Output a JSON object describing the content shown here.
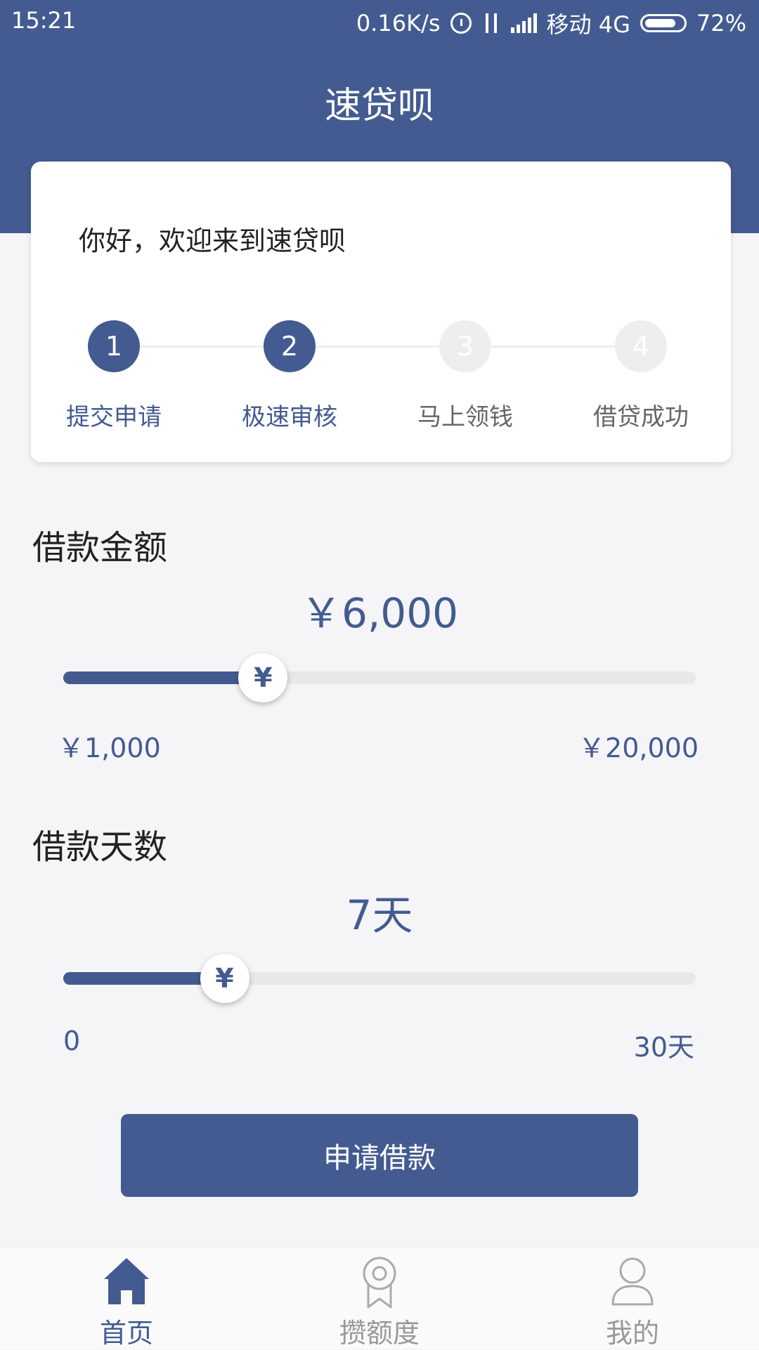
{
  "status_bar": {
    "time": "15:21",
    "speed": "0.16K/s",
    "carrier": "移动 4G",
    "battery": "72%"
  },
  "header": {
    "title": "速贷呗"
  },
  "welcome_card": {
    "greeting": "你好，欢迎来到速贷呗",
    "steps": [
      {
        "number": "1",
        "label": "提交申请",
        "state": "active"
      },
      {
        "number": "2",
        "label": "极速审核",
        "state": "active"
      },
      {
        "number": "3",
        "label": "马上领钱",
        "state": "inactive"
      },
      {
        "number": "4",
        "label": "借贷成功",
        "state": "inactive"
      }
    ]
  },
  "loan_amount": {
    "title": "借款金额",
    "value": "￥6,000",
    "min_label": "￥1,000",
    "max_label": "￥20,000",
    "thumb_symbol": "¥",
    "fraction": 0.316
  },
  "loan_days": {
    "title": "借款天数",
    "value": "7天",
    "min_label": "0",
    "max_label": "30天",
    "thumb_symbol": "¥",
    "fraction": 0.255
  },
  "apply_button": {
    "label": "申请借款"
  },
  "bottom_nav": {
    "items": [
      {
        "label": "首页",
        "icon": "home-icon",
        "active": true
      },
      {
        "label": "攒额度",
        "icon": "badge-icon",
        "active": false
      },
      {
        "label": "我的",
        "icon": "user-icon",
        "active": false
      }
    ]
  },
  "colors": {
    "primary": "#435b90",
    "background": "#f5f5f7",
    "inactive_step": "#eeeeee",
    "slider_track": "#e8e8e8"
  }
}
